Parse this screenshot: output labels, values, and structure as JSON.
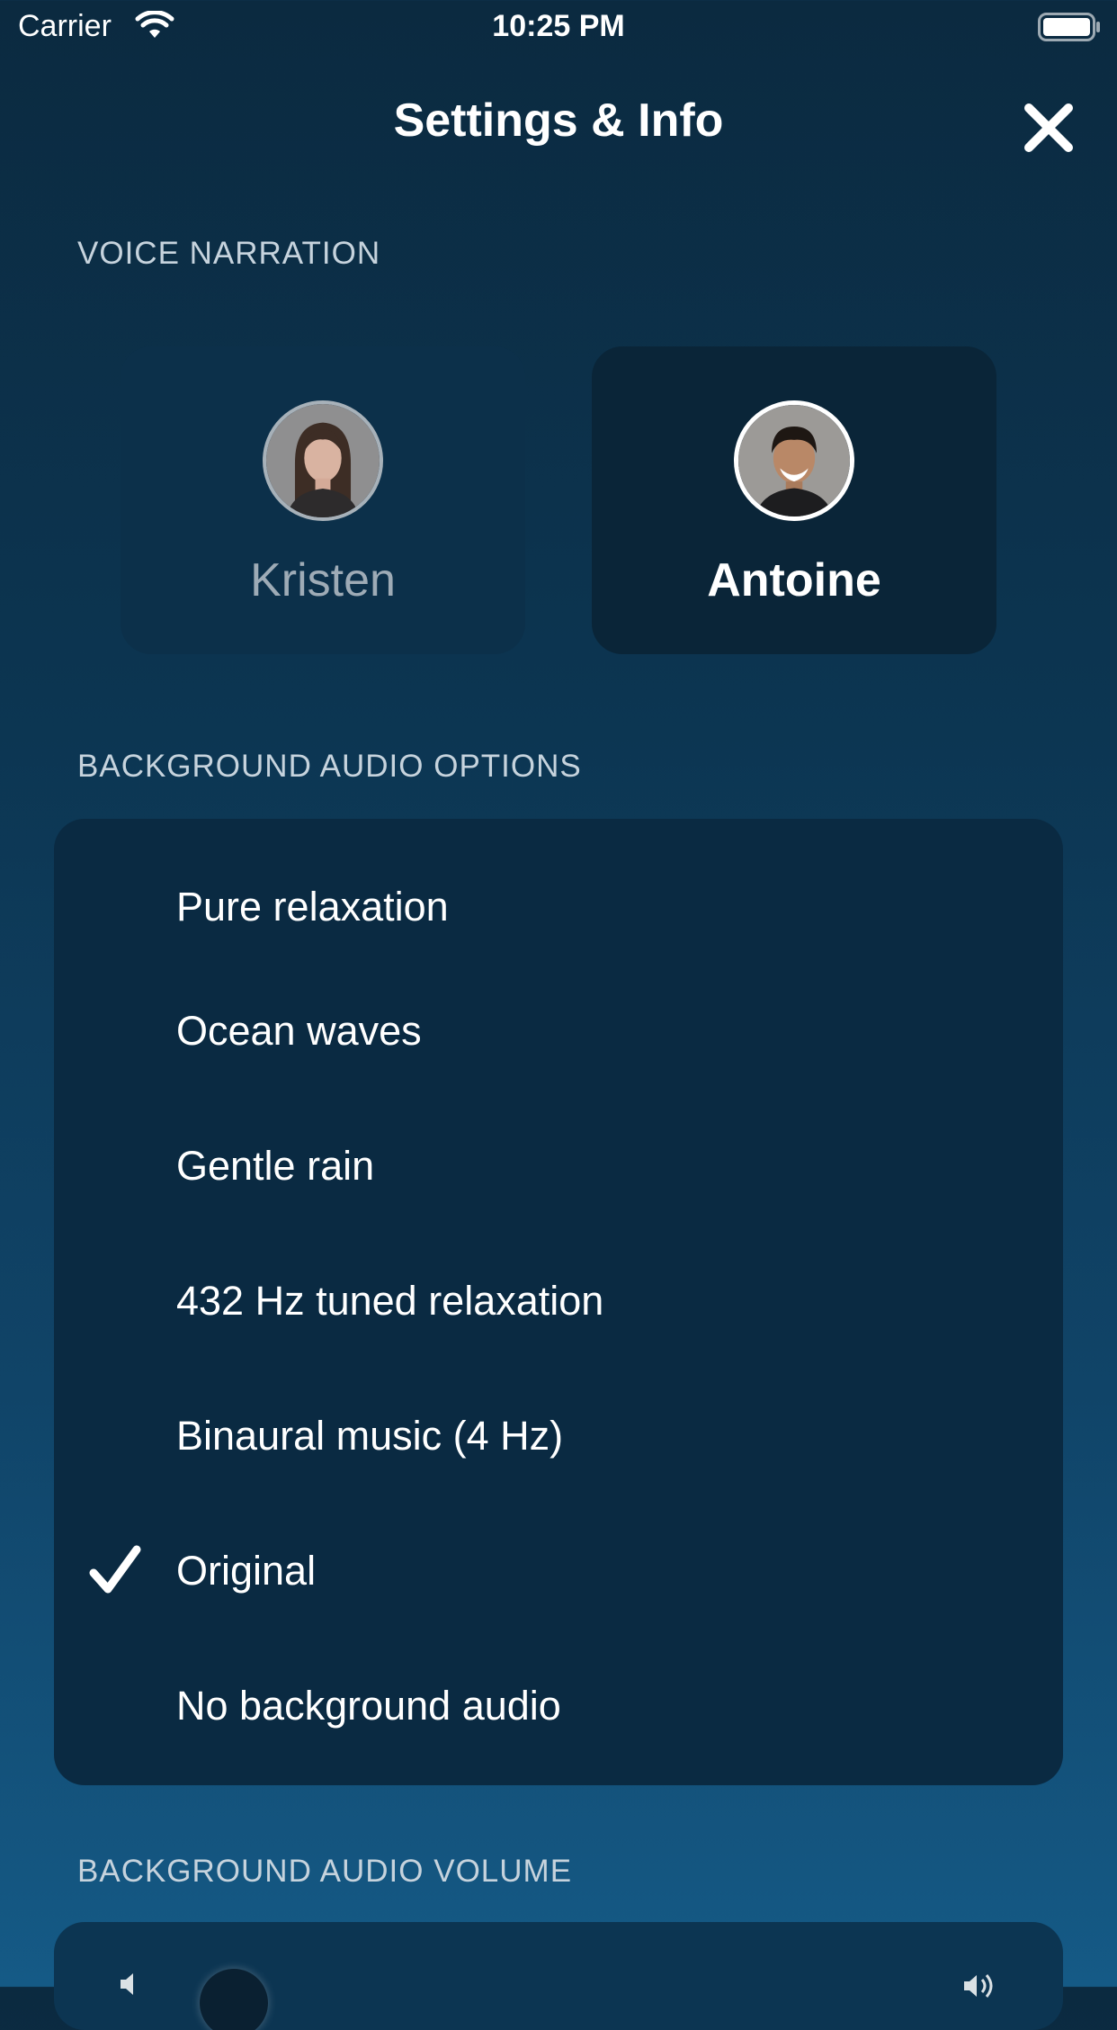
{
  "status_bar": {
    "carrier": "Carrier",
    "time": "10:25 PM"
  },
  "header": {
    "title": "Settings & Info"
  },
  "voice_narration": {
    "section_title": "VOICE NARRATION",
    "narrators": [
      {
        "name": "Kristen",
        "selected": false
      },
      {
        "name": "Antoine",
        "selected": true
      }
    ]
  },
  "background_audio": {
    "section_title": "BACKGROUND AUDIO OPTIONS",
    "options": [
      {
        "label": "Pure relaxation",
        "selected": false
      },
      {
        "label": "Ocean waves",
        "selected": false
      },
      {
        "label": "Gentle rain",
        "selected": false
      },
      {
        "label": "432 Hz tuned relaxation",
        "selected": false
      },
      {
        "label": "Binaural music (4 Hz)",
        "selected": false
      },
      {
        "label": "Original",
        "selected": true
      },
      {
        "label": "No background audio",
        "selected": false
      }
    ]
  },
  "volume": {
    "section_title": "BACKGROUND AUDIO VOLUME"
  },
  "colors": {
    "accent": "#ffffff",
    "background_top": "#0b2a40",
    "background_bottom": "#155a86",
    "panel": "#0a2a42"
  }
}
